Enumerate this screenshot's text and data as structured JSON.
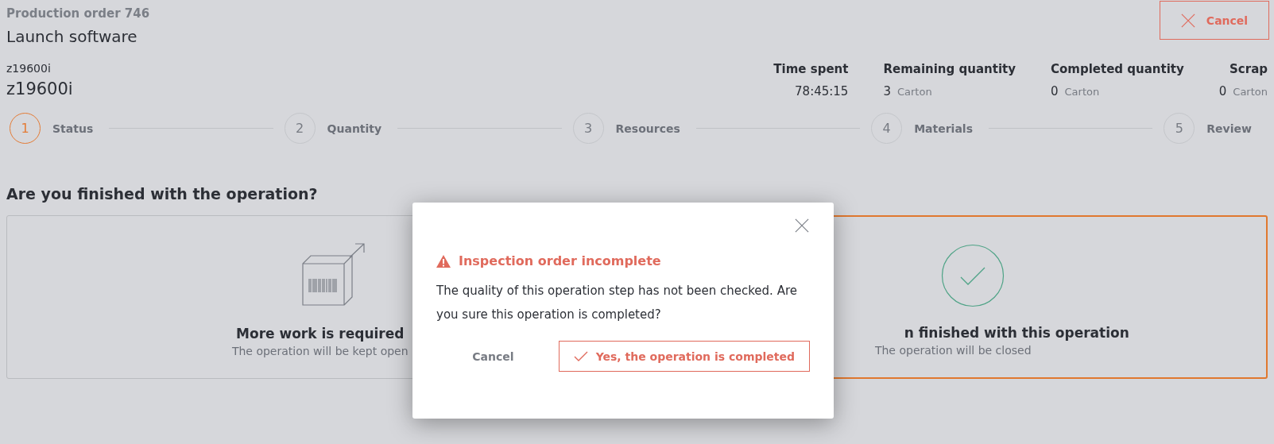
{
  "header": {
    "order": "Production order 746",
    "title": "Launch software",
    "cancel": "Cancel"
  },
  "product": {
    "code": "z19600i",
    "name": "z19600i"
  },
  "stats": [
    {
      "label": "Time spent",
      "value": "78:45:15"
    },
    {
      "label": "Remaining quantity",
      "value": "3",
      "unit": "Carton"
    },
    {
      "label": "Completed quantity",
      "value": "0",
      "unit": "Carton"
    },
    {
      "label": "Scrap",
      "value": "0",
      "unit": "Carton"
    }
  ],
  "steps": [
    {
      "number": "1",
      "label": "Status",
      "selected": true
    },
    {
      "number": "2",
      "label": "Quantity",
      "selected": false
    },
    {
      "number": "3",
      "label": "Resources",
      "selected": false
    },
    {
      "number": "4",
      "label": "Materials",
      "selected": false
    },
    {
      "number": "5",
      "label": "Review",
      "selected": false
    }
  ],
  "question": "Are you finished with the operation?",
  "options": [
    {
      "kind": "box",
      "title": "More work is required",
      "subtitle": "The operation will be kept open",
      "selected": false
    },
    {
      "kind": "check",
      "title": "n finished with this operation",
      "subtitle": "The operation will be closed",
      "selected": true
    }
  ],
  "dialog": {
    "title": "Inspection order incomplete",
    "message": "The quality of this operation step has not been checked. Are you sure this operation is completed?",
    "cancel": "Cancel",
    "confirm": "Yes, the operation is completed"
  }
}
